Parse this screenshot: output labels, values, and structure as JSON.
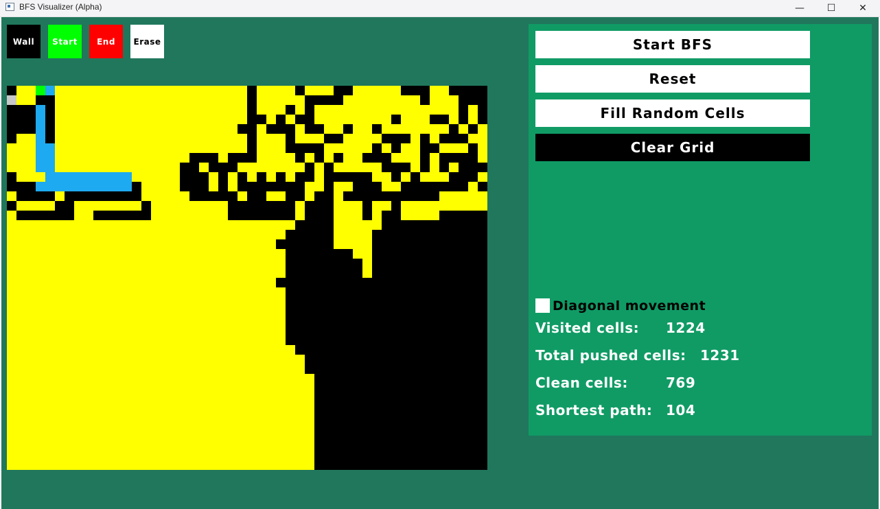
{
  "window": {
    "title": "BFS Visualizer (Alpha)",
    "minimize_glyph": "—",
    "maximize_glyph": "☐",
    "close_glyph": "✕"
  },
  "tools": [
    {
      "label": "Wall",
      "bg": "#000000",
      "fg": "#ffffff"
    },
    {
      "label": "Start",
      "bg": "#00ff00",
      "fg": "#ffffff"
    },
    {
      "label": "End",
      "bg": "#ff0000",
      "fg": "#ffffff"
    },
    {
      "label": "Erase",
      "bg": "#ffffff",
      "fg": "#000000"
    }
  ],
  "actions": {
    "start_bfs": "Start BFS",
    "reset": "Reset",
    "fill_random": "Fill Random Cells",
    "clear_grid": "Clear Grid"
  },
  "options": {
    "diagonal_label": "Diagonal movement",
    "diagonal_checked": false
  },
  "stats": {
    "visited_label": "Visited cells:",
    "visited_value": "1224",
    "pushed_label": "Total pushed cells:",
    "pushed_value": "1231",
    "clean_label": "Clean cells:",
    "clean_value": "769",
    "path_label": "Shortest path:",
    "path_value": "104"
  },
  "colors": {
    "background": "#20775c",
    "panel": "#109b65",
    "visited": "#ffff00",
    "wall": "#000000",
    "unvisited": "#c8c8c8",
    "path": "#1eaaf0",
    "start": "#00ff00",
    "end": "#ff00ff",
    "frontier": "#808000"
  },
  "grid": {
    "cols": 50,
    "rows": 40,
    "legend": "0=visited 1=wall 2=unvisited 3=path 4=start 5=end 6=frontier",
    "cells": [
      "10043000000000000000000001000010001100000111001111",
      "20011000000000000000000001000001111000000001000111",
      "11131000000000000000000001000101000000000000000101",
      "11131000000000000000000001101011000000001000110101",
      "11131000000000000000000011011101100100100000001010",
      "10031000000000000000000001000100011000011101011100",
      "00033000000000000000000001000111100000101001100010",
      "00033000000000000001110111000010101001110001011110",
      "00033000000000000011011100000001010000011101010111",
      "10003333333330000011101010101011011111001010001110",
      "11133333333331000011101011111110010011100111111101",
      "01111011111111000001111101100110110111111111100000",
      "10000110000000100000000111111101110001001000000000",
      "01111110011111100000000111111101110001011000011111",
      "00000000000000000000000000000011110000011111111111",
      "00000000000000000000000000000111110000111111111111",
      "00000000000000000000000000001111110000111111111111",
      "00000000000000000000000000000111111100111111111111",
      "00000000000000000000000000000111111110111111111111",
      "00000000000000000000000000000111111110111111111111",
      "00000000000000000000000000001111111111111111111111",
      "00000000000000000000000000000111111111111111111111",
      "00000000000000000000000000000111111111111111111111",
      "00000000000000000000000000000111111111111111111111",
      "00000000000000000000000000000111111111111111111111",
      "00000000000000000000000000000111111111111111111111",
      "00000000000000000000000000000111111111111111111111",
      "00000000000000000000000000000011111111111111111111",
      "00000000000000000000000000000001111111111111111111",
      "00000000000000000000000000000001111111111111111111",
      "00000000000000000000000000000000111111111111111111",
      "00000000000000000000000000000000111111111111111111",
      "00000000000000000000000000000000111111111111111111",
      "00000000000000000000000000000000111111111111111111",
      "00000000000000000000000000000000111111111111111111",
      "00000000000000000000000000000000111111111111111111",
      "00000000000000000000000000000000111111111111111111",
      "00000000000000000000000000000000111111111111111111",
      "00000000000000000000000000000000111111111111111111",
      "00000000000000000000000000000000111111111111111111"
    ]
  }
}
